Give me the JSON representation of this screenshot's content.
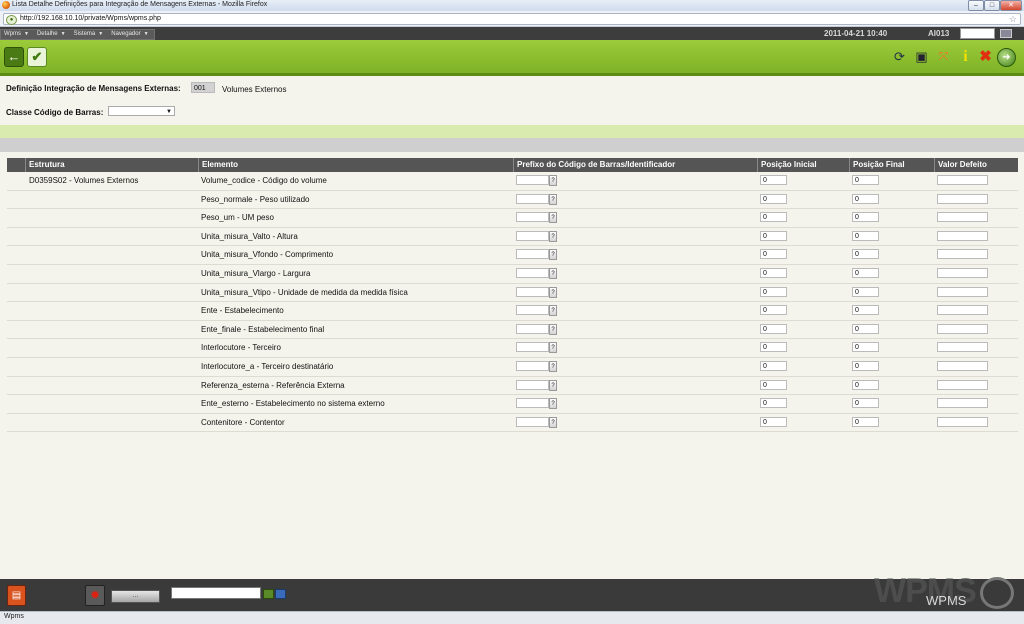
{
  "browser": {
    "window_title": "Lista Detalhe Definições para Integração de Mensagens Externas - Mozilla Firefox",
    "url": "http://192.168.10.10/private/Wpms/wpms.php",
    "status_text": "Wpms",
    "minimize": "–",
    "maximize": "□",
    "close": "✕"
  },
  "menubar": {
    "menus": [
      {
        "label": "Wpms"
      },
      {
        "label": "Detalhe"
      },
      {
        "label": "Sistema"
      },
      {
        "label": "Navegador"
      }
    ],
    "datetime": "2011-04-21 10:40",
    "user": "AI013"
  },
  "toolbar": {
    "icons": [
      "back-arrow-icon",
      "confirm-check-icon",
      "refresh-icon",
      "export-icon",
      "expand-icon",
      "info-icon",
      "close-icon",
      "logout-icon"
    ]
  },
  "form": {
    "definition_label": "Definição Integração de Mensagens Externas:",
    "definition_code": "001",
    "definition_name": "Volumes Externos",
    "class_label": "Classe Código de Barras:",
    "class_value": ""
  },
  "table": {
    "headers": [
      "Estrutura",
      "Elemento",
      "Prefixo do Código de Barras/Identificador",
      "Posição Inicial",
      "Posição Final",
      "Valor Defeito"
    ],
    "help_button": "?",
    "rows": [
      {
        "estrutura": "D0359S02 - Volumes Externos",
        "elemento": "Volume_codice - Código do volume",
        "prefixo": "",
        "inicial": "0",
        "final": "0",
        "defeito": ""
      },
      {
        "estrutura": "",
        "elemento": "Peso_normale - Peso utilizado",
        "prefixo": "",
        "inicial": "0",
        "final": "0",
        "defeito": ""
      },
      {
        "estrutura": "",
        "elemento": "Peso_um - UM peso",
        "prefixo": "",
        "inicial": "0",
        "final": "0",
        "defeito": ""
      },
      {
        "estrutura": "",
        "elemento": "Unita_misura_Valto - Altura",
        "prefixo": "",
        "inicial": "0",
        "final": "0",
        "defeito": ""
      },
      {
        "estrutura": "",
        "elemento": "Unita_misura_Vfondo - Comprimento",
        "prefixo": "",
        "inicial": "0",
        "final": "0",
        "defeito": ""
      },
      {
        "estrutura": "",
        "elemento": "Unita_misura_Vlargo - Largura",
        "prefixo": "",
        "inicial": "0",
        "final": "0",
        "defeito": ""
      },
      {
        "estrutura": "",
        "elemento": "Unita_misura_Vtipo - Unidade de medida da medida física",
        "prefixo": "",
        "inicial": "0",
        "final": "0",
        "defeito": ""
      },
      {
        "estrutura": "",
        "elemento": "Ente - Estabelecimento",
        "prefixo": "",
        "inicial": "0",
        "final": "0",
        "defeito": ""
      },
      {
        "estrutura": "",
        "elemento": "Ente_finale - Estabelecimento final",
        "prefixo": "",
        "inicial": "0",
        "final": "0",
        "defeito": ""
      },
      {
        "estrutura": "",
        "elemento": "Interlocutore - Terceiro",
        "prefixo": "",
        "inicial": "0",
        "final": "0",
        "defeito": ""
      },
      {
        "estrutura": "",
        "elemento": "Interlocutore_a - Terceiro destinatário",
        "prefixo": "",
        "inicial": "0",
        "final": "0",
        "defeito": ""
      },
      {
        "estrutura": "",
        "elemento": "Referenza_esterna - Referência Externa",
        "prefixo": "",
        "inicial": "0",
        "final": "0",
        "defeito": ""
      },
      {
        "estrutura": "",
        "elemento": "Ente_esterno - Estabelecimento no sistema externo",
        "prefixo": "",
        "inicial": "0",
        "final": "0",
        "defeito": ""
      },
      {
        "estrutura": "",
        "elemento": "Contenitore - Contentor",
        "prefixo": "",
        "inicial": "0",
        "final": "0",
        "defeito": ""
      }
    ]
  },
  "bottom": {
    "button3_label": "...",
    "input_value": "",
    "logo_text": "WPMS",
    "logo_sub": "WPMS"
  }
}
